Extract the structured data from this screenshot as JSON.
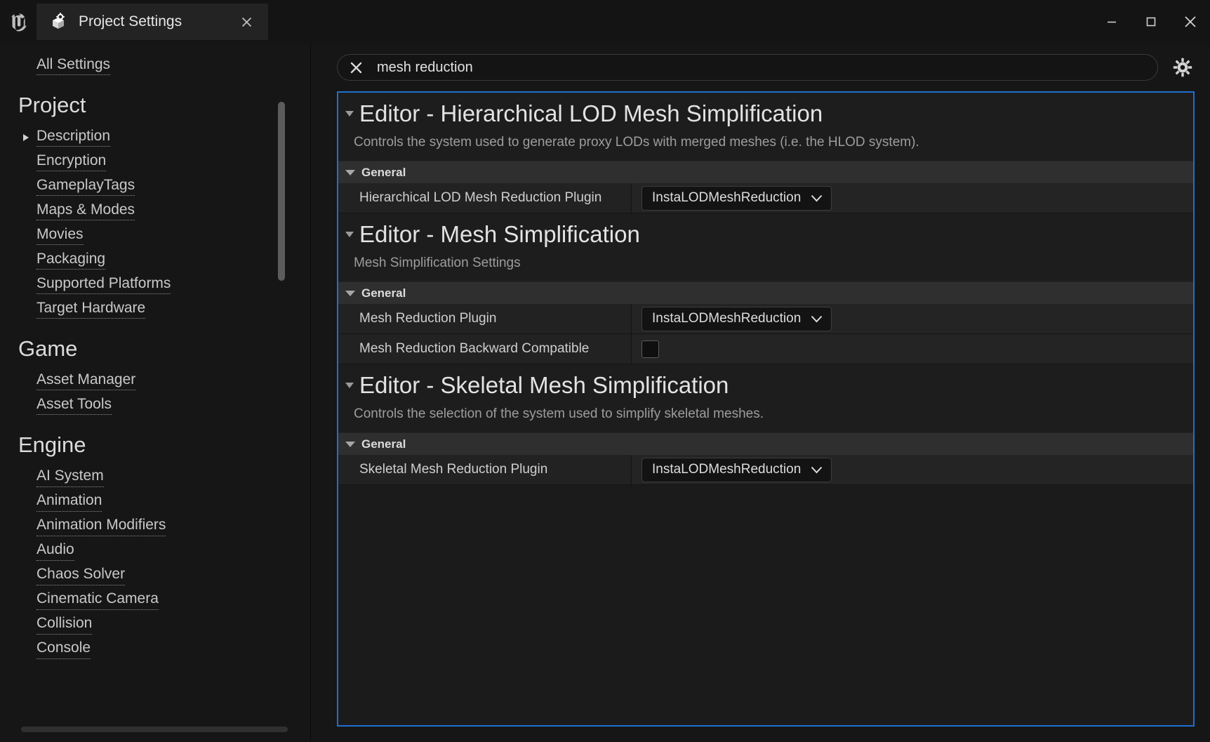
{
  "window": {
    "logo_icon": "unreal-engine-logo",
    "tab": {
      "icon": "project-settings-box-gear-icon",
      "label": "Project Settings",
      "close_icon": "close-icon"
    },
    "controls": {
      "minimize_icon": "minimize-icon",
      "maximize_icon": "maximize-icon",
      "close_icon": "close-icon"
    }
  },
  "sidebar": {
    "top_link": "All Settings",
    "groups": [
      {
        "title": "Project",
        "items": [
          {
            "label": "Description",
            "expandable": true
          },
          {
            "label": "Encryption",
            "expandable": false
          },
          {
            "label": "GameplayTags",
            "expandable": false
          },
          {
            "label": "Maps & Modes",
            "expandable": false
          },
          {
            "label": "Movies",
            "expandable": false
          },
          {
            "label": "Packaging",
            "expandable": false
          },
          {
            "label": "Supported Platforms",
            "expandable": false
          },
          {
            "label": "Target Hardware",
            "expandable": false
          }
        ]
      },
      {
        "title": "Game",
        "items": [
          {
            "label": "Asset Manager",
            "expandable": false
          },
          {
            "label": "Asset Tools",
            "expandable": false
          }
        ]
      },
      {
        "title": "Engine",
        "items": [
          {
            "label": "AI System",
            "expandable": false
          },
          {
            "label": "Animation",
            "expandable": false
          },
          {
            "label": "Animation Modifiers",
            "expandable": false
          },
          {
            "label": "Audio",
            "expandable": false
          },
          {
            "label": "Chaos Solver",
            "expandable": false
          },
          {
            "label": "Cinematic Camera",
            "expandable": false
          },
          {
            "label": "Collision",
            "expandable": false
          },
          {
            "label": "Console",
            "expandable": false
          }
        ]
      }
    ]
  },
  "search": {
    "clear_icon": "clear-x-icon",
    "value": "mesh reduction",
    "placeholder": "Search",
    "gear_icon": "gear-icon"
  },
  "settings": {
    "sections": [
      {
        "title": "Editor - Hierarchical LOD Mesh Simplification",
        "description": "Controls the system used to generate proxy LODs with merged meshes (i.e. the HLOD system).",
        "group_label": "General",
        "properties": [
          {
            "name": "Hierarchical LOD Mesh Reduction Plugin",
            "type": "combo",
            "value": "InstaLODMeshReduction"
          }
        ]
      },
      {
        "title": "Editor - Mesh Simplification",
        "description": "Mesh Simplification Settings",
        "group_label": "General",
        "properties": [
          {
            "name": "Mesh Reduction Plugin",
            "type": "combo",
            "value": "InstaLODMeshReduction"
          },
          {
            "name": "Mesh Reduction Backward Compatible",
            "type": "checkbox",
            "checked": false
          }
        ]
      },
      {
        "title": "Editor - Skeletal Mesh Simplification",
        "description": "Controls the selection of the system used to simplify skeletal meshes.",
        "group_label": "General",
        "properties": [
          {
            "name": "Skeletal Mesh Reduction Plugin",
            "type": "combo",
            "value": "InstaLODMeshReduction"
          }
        ]
      }
    ]
  },
  "colors": {
    "focus_border": "#1f6fd0",
    "window_bg": "#161616",
    "panel_bg": "#1b1b1b",
    "group_bar": "#2f2f2f"
  }
}
